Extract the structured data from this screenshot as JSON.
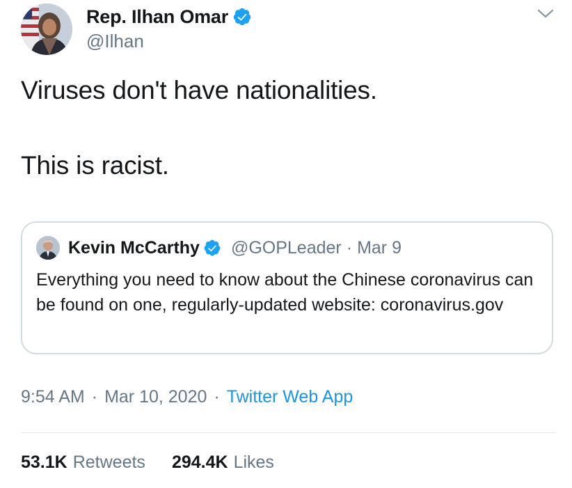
{
  "author": {
    "display_name": "Rep. Ilhan Omar",
    "handle": "@Ilhan",
    "verified": true,
    "avatar_icon": "profile-photo"
  },
  "tweet": {
    "paragraphs": [
      "Viruses don't have nationalities.",
      "This is racist."
    ]
  },
  "quoted_tweet": {
    "display_name": "Kevin McCarthy",
    "handle": "@GOPLeader",
    "separator": "·",
    "date": "Mar 9",
    "verified": true,
    "text": "Everything you need to know about the Chinese coronavirus can be found on one, regularly-updated website: coronavirus.gov"
  },
  "meta": {
    "time": "9:54 AM",
    "separator": "·",
    "date": "Mar 10, 2020",
    "source": "Twitter Web App"
  },
  "stats": {
    "retweets_count": "53.1K",
    "retweets_label": "Retweets",
    "likes_count": "294.4K",
    "likes_label": "Likes"
  },
  "colors": {
    "verified_blue": "#1da1f2",
    "link_blue": "#1b95e0",
    "secondary_text": "#657786",
    "border": "#d3dbe2"
  },
  "icons": [
    "verified-badge-icon",
    "chevron-down-icon"
  ]
}
